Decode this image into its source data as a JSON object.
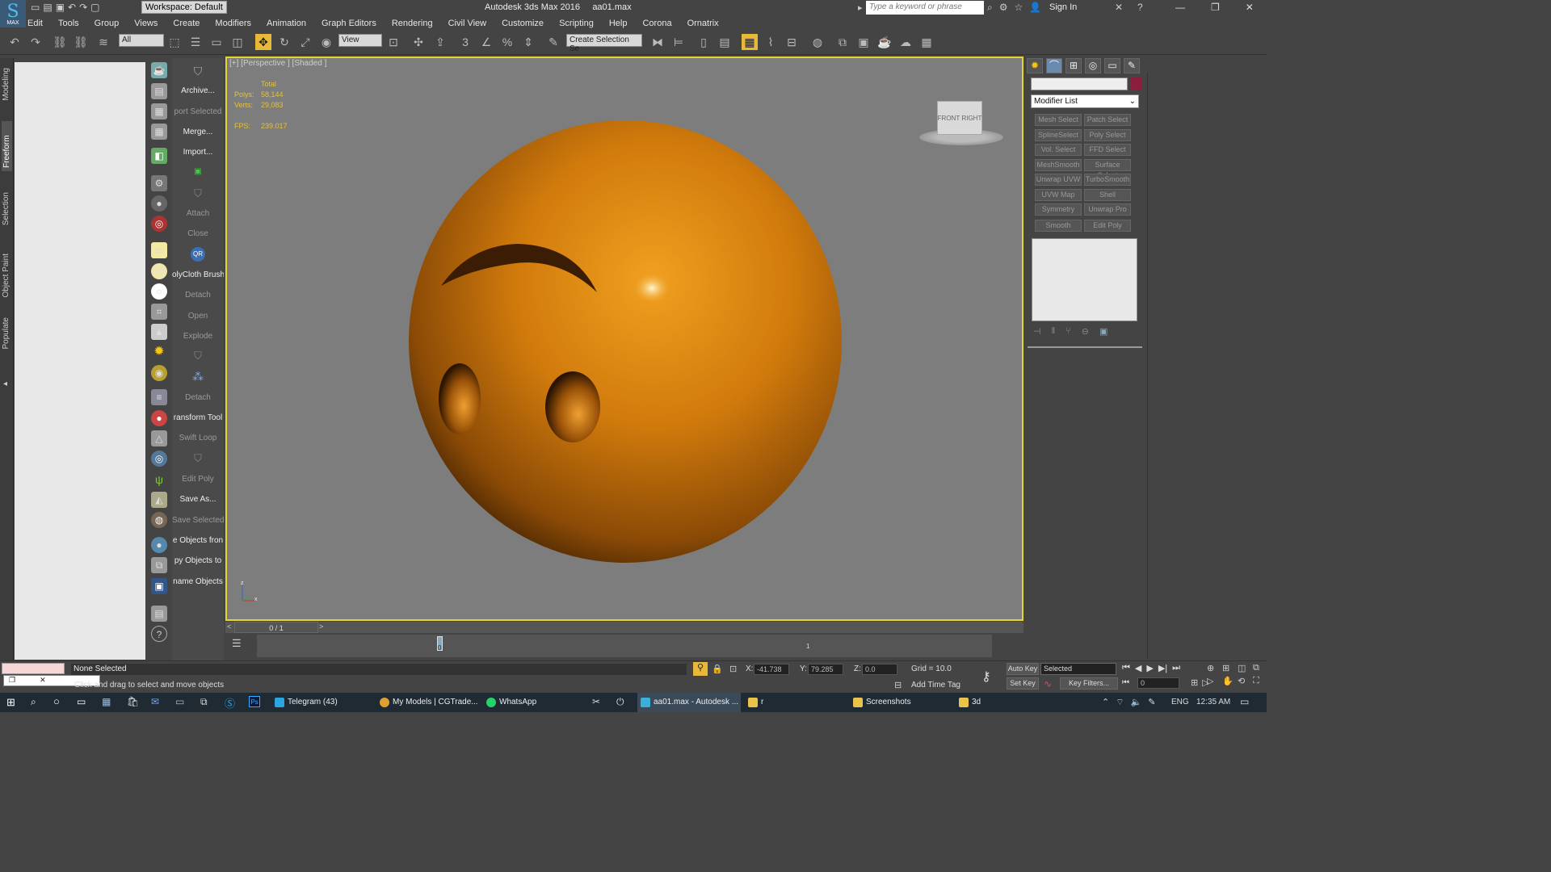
{
  "titlebar": {
    "app_title": "Autodesk 3ds Max 2016",
    "file_name": "aa01.max",
    "workspace": "Workspace: Default",
    "search_placeholder": "Type a keyword or phrase",
    "sign_in": "Sign In",
    "logo_text": "MAX"
  },
  "menu": [
    "Edit",
    "Tools",
    "Group",
    "Views",
    "Create",
    "Modifiers",
    "Animation",
    "Graph Editors",
    "Rendering",
    "Civil View",
    "Customize",
    "Scripting",
    "Help",
    "Corona",
    "Ornatrix"
  ],
  "toolbar": {
    "selection_filter": "All",
    "ref_coord": "View",
    "selection_set": "Create Selection Se"
  },
  "ribbon_tabs": [
    "Modeling",
    "Freeform",
    "Selection",
    "Object Paint",
    "Populate"
  ],
  "left_labels": [
    {
      "text": "Archive...",
      "dim": false
    },
    {
      "text": "port Selected",
      "dim": true
    },
    {
      "text": "Merge...",
      "dim": false
    },
    {
      "text": "Import...",
      "dim": false
    },
    {
      "text": "",
      "dim": false
    },
    {
      "text": "",
      "dim": false
    },
    {
      "text": "Attach",
      "dim": true
    },
    {
      "text": "Close",
      "dim": true
    },
    {
      "text": "",
      "dim": false
    },
    {
      "text": "olyCloth Brush",
      "dim": false
    },
    {
      "text": "Detach",
      "dim": true
    },
    {
      "text": "Open",
      "dim": true
    },
    {
      "text": "Explode",
      "dim": true
    },
    {
      "text": "",
      "dim": false
    },
    {
      "text": "",
      "dim": false
    },
    {
      "text": "Detach",
      "dim": true
    },
    {
      "text": "ransform Tool",
      "dim": false
    },
    {
      "text": "Swift Loop",
      "dim": true
    },
    {
      "text": "",
      "dim": false
    },
    {
      "text": "Edit Poly",
      "dim": true
    },
    {
      "text": "Save As...",
      "dim": false
    },
    {
      "text": "Save Selected",
      "dim": true
    },
    {
      "text": "e Objects fron",
      "dim": false
    },
    {
      "text": "py Objects to",
      "dim": false
    },
    {
      "text": "name Objects",
      "dim": false
    }
  ],
  "viewport": {
    "label": "[+] [Perspective ] [Shaded ]",
    "stats_header": "Total",
    "polys_label": "Polys:",
    "polys_value": "58,144",
    "verts_label": "Verts:",
    "verts_value": "29,083",
    "fps_label": "FPS:",
    "fps_value": "239.017",
    "viewcube_front": "FRONT",
    "viewcube_right": "RIGHT",
    "axis_z": "z",
    "axis_x": "x",
    "object_color": "#d98a12",
    "bg_color": "#7d7d7d"
  },
  "timeline": {
    "frame_display": "0 / 1",
    "prev": "<",
    "next": ">",
    "tick_0": "0",
    "tick_1": "1"
  },
  "command_panel": {
    "modifier_list": "Modifier List",
    "buttons": [
      [
        "Mesh Select",
        "Patch Select"
      ],
      [
        "SplineSelect",
        "Poly Select"
      ],
      [
        "Vol. Select",
        "FFD Select"
      ],
      [
        "MeshSmooth",
        "Surface Select"
      ],
      [
        "Unwrap UVW",
        "TurboSmooth"
      ],
      [
        "UVW Map",
        "Shell"
      ],
      [
        "Symmetry",
        "Unwrap Pro"
      ],
      [
        "Smooth",
        "Edit Poly"
      ]
    ],
    "swatch_color": "#8b1e3f"
  },
  "status": {
    "selection": "None Selected",
    "prompt": "Click and drag to select and move objects",
    "x_label": "X:",
    "x_value": "-41.738",
    "y_label": "Y:",
    "y_value": "79.285",
    "z_label": "Z:",
    "z_value": "0.0",
    "grid": "Grid = 10.0",
    "add_time_tag": "Add Time Tag",
    "auto_key": "Auto Key",
    "set_key": "Set Key",
    "key_mode": "Selected",
    "key_filters": "Key Filters...",
    "frame": "0"
  },
  "taskbar": {
    "items": [
      {
        "label": "Telegram (43)",
        "color": "#2ca5e0",
        "active": false
      },
      {
        "label": "My Models | CGTrade...",
        "color": "#e0a030",
        "active": false
      },
      {
        "label": "WhatsApp",
        "color": "#25d366",
        "active": false
      },
      {
        "label": "aa01.max - Autodesk ...",
        "color": "#3ab0d8",
        "active": true
      },
      {
        "label": "r",
        "color": "#e8c44a",
        "active": false
      },
      {
        "label": "Screenshots",
        "color": "#e8c44a",
        "active": false
      },
      {
        "label": "3d",
        "color": "#e8c44a",
        "active": false
      }
    ],
    "lang": "ENG",
    "time": "12:35 AM"
  }
}
